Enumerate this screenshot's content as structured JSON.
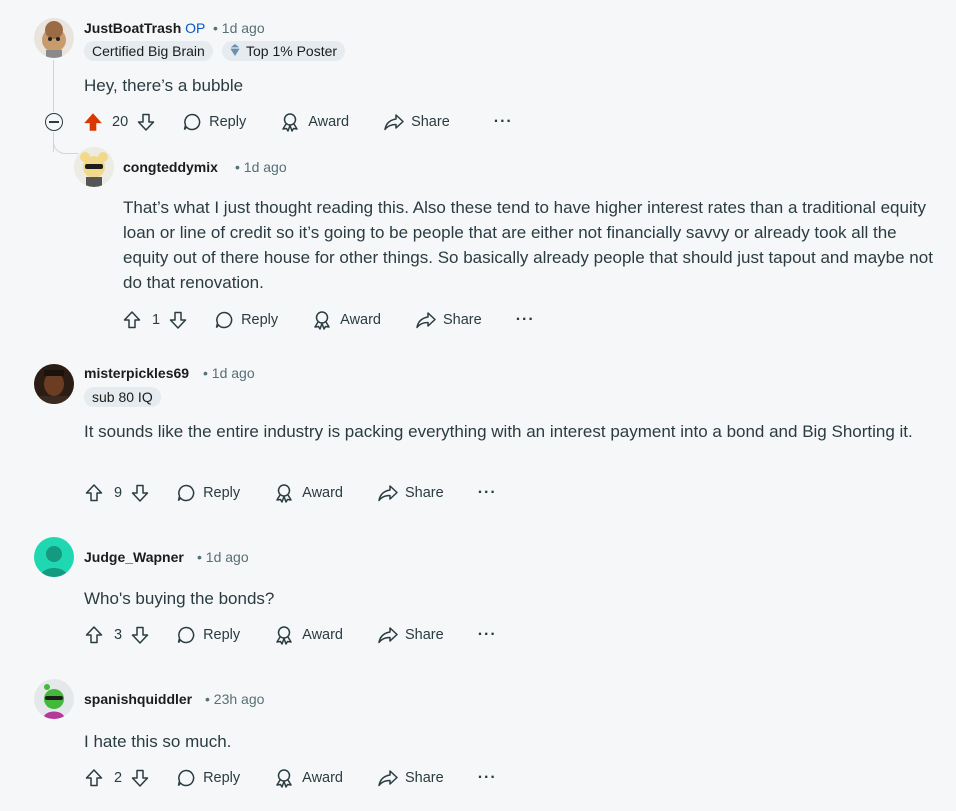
{
  "comments": [
    {
      "author": "JustBoatTrash",
      "op_label": "OP",
      "time": "• 1d ago",
      "flairs": [
        "Certified Big Brain",
        "Top 1% Poster"
      ],
      "text": "Hey, there’s a bubble",
      "votes": "20",
      "upvoted": true,
      "actions": {
        "reply": "Reply",
        "award": "Award",
        "share": "Share"
      }
    },
    {
      "author": "congteddymix",
      "time": "• 1d ago",
      "text": "That’s what I just thought reading this. Also these tend to have higher interest rates than a traditional equity loan or line of credit so it’s going to be people that are either not financially savvy or already took all the equity out of there house for other things. So basically already people that should just tapout and maybe not do that renovation.",
      "votes": "1",
      "actions": {
        "reply": "Reply",
        "award": "Award",
        "share": "Share"
      }
    },
    {
      "author": "misterpickles69",
      "time": "• 1d ago",
      "flairs": [
        "sub 80 IQ"
      ],
      "text": "It sounds like the entire industry is packing everything with an interest payment into a bond and Big Shorting it.",
      "votes": "9",
      "actions": {
        "reply": "Reply",
        "award": "Award",
        "share": "Share"
      }
    },
    {
      "author": "Judge_Wapner",
      "time": "• 1d ago",
      "text": "Who's buying the bonds?",
      "votes": "3",
      "actions": {
        "reply": "Reply",
        "award": "Award",
        "share": "Share"
      }
    },
    {
      "author": "spanishquiddler",
      "time": "• 23h ago",
      "text": "I hate this so much.",
      "votes": "2",
      "actions": {
        "reply": "Reply",
        "award": "Award",
        "share": "Share"
      }
    }
  ],
  "icons": {
    "upvote": "upvote-arrow-icon",
    "downvote": "downvote-arrow-icon",
    "reply": "speech-bubble-icon",
    "award": "award-ribbon-icon",
    "share": "share-arrow-icon",
    "more": "more-options-icon",
    "collapse": "collapse-thread-icon",
    "top_poster": "top-poster-badge-icon"
  },
  "colors": {
    "upvote_active": "#d93900",
    "op": "#0a57c2",
    "meta": "#576f76",
    "flair_bg": "#e5ebee"
  }
}
